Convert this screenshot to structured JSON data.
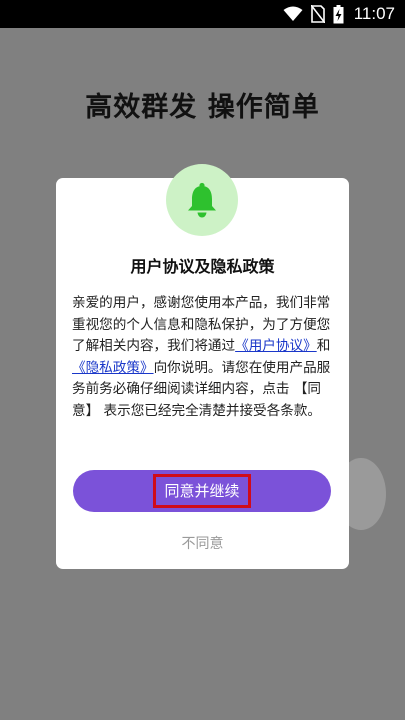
{
  "status_bar": {
    "time": "11:07",
    "icons": [
      "wifi-icon",
      "no-sim-icon",
      "battery-charging-icon"
    ]
  },
  "headline": "高效群发  操作简单",
  "dialog": {
    "icon": "bell-icon",
    "title": "用户协议及隐私政策",
    "body_part1": "亲爱的用户，感谢您使用本产品，我们非常重视您的个人信息和隐私保护，为了方便您了解相关内容，我们将通过",
    "user_agreement_link": "《用户协议》",
    "and_text": "和",
    "privacy_policy_link": "《隐私政策》",
    "body_part2": "向你说明。请您在使用产品服务前务必确仔细阅读详细内容，点击 【同意】 表示您已经完全清楚并接受各条款。",
    "agree_button": "同意并继续",
    "disagree_button": "不同意"
  },
  "colors": {
    "overlay": "#808080",
    "accent_purple": "#7b52d9",
    "bell_green": "#2ec12e",
    "link_blue": "#1a37c9",
    "highlight_red": "#d00b1a"
  }
}
